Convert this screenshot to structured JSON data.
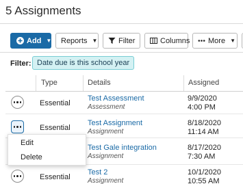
{
  "page": {
    "title": "5 Assignments"
  },
  "toolbar": {
    "add_label": "Add",
    "reports_label": "Reports",
    "filter_label": "Filter",
    "columns_label": "Columns",
    "more_label": "More"
  },
  "filter": {
    "label": "Filter:",
    "chip": "Date due is this school year"
  },
  "table": {
    "headers": {
      "type": "Type",
      "details": "Details",
      "assigned": "Assigned"
    },
    "rows": [
      {
        "type": "Essential",
        "title": "Test Assessment",
        "category": "Assessment",
        "date": "9/9/2020",
        "time": "4:00 PM"
      },
      {
        "type": "Essential",
        "title": "Test Assignment",
        "category": "Assignment",
        "date": "8/18/2020",
        "time": "11:14 AM"
      },
      {
        "type": "",
        "title": "Test Gale integration",
        "category": "Assignment",
        "date": "8/17/2020",
        "time": "7:30 AM"
      },
      {
        "type": "Essential",
        "title": "Test 2",
        "category": "Assignment",
        "date": "10/1/2020",
        "time": "10:55 AM"
      }
    ]
  },
  "context_menu": {
    "items": [
      "Edit",
      "Delete"
    ]
  },
  "colors": {
    "primary": "#1a6aa6",
    "chip_bg": "#d4f1f3",
    "chip_border": "#77cdd4"
  },
  "icons": {
    "add": "plus-circle-icon",
    "caret": "caret-down-icon",
    "filter": "funnel-icon",
    "columns": "columns-icon",
    "more": "ellipsis-icon",
    "row_actions": "ellipsis-circle-icon"
  }
}
